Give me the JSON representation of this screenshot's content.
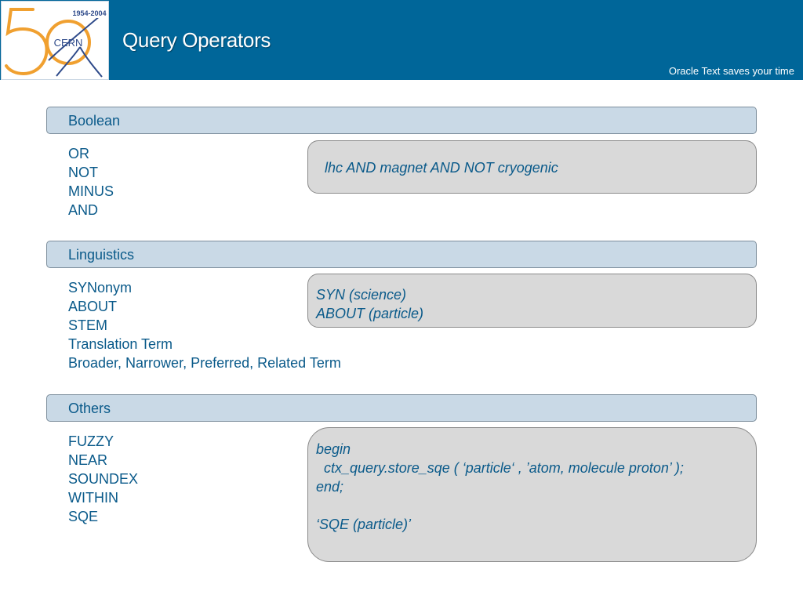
{
  "header": {
    "logo_text": "CERN",
    "logo_years": "1954-2004",
    "title": "Query Operators",
    "tagline": "Oracle Text saves your time"
  },
  "sections": [
    {
      "title": "Boolean",
      "operators": [
        "OR",
        "NOT",
        "MINUS",
        "AND"
      ],
      "example_lines": [
        "lhc AND magnet AND NOT cryogenic"
      ]
    },
    {
      "title": "Linguistics",
      "operators": [
        "SYNonym",
        "ABOUT",
        "STEM",
        "Translation Term",
        "Broader, Narrower, Preferred, Related Term"
      ],
      "example_lines": [
        "SYN (science)",
        "ABOUT (particle)"
      ]
    },
    {
      "title": "Others",
      "operators": [
        "FUZZY",
        "NEAR",
        "SOUNDEX",
        "WITHIN",
        "SQE"
      ],
      "example_lines": [
        "begin",
        "  ctx_query.store_sqe ( ‘particle‘ , ’atom, molecule proton’ );",
        "end;",
        "",
        "‘SQE (particle)’"
      ]
    }
  ],
  "colors": {
    "header_bg": "#006699",
    "section_bar_bg": "#c9d9e6",
    "text_blue": "#0a5a8a",
    "example_bg": "#d9d9d9",
    "logo_orange": "#f0a030"
  }
}
